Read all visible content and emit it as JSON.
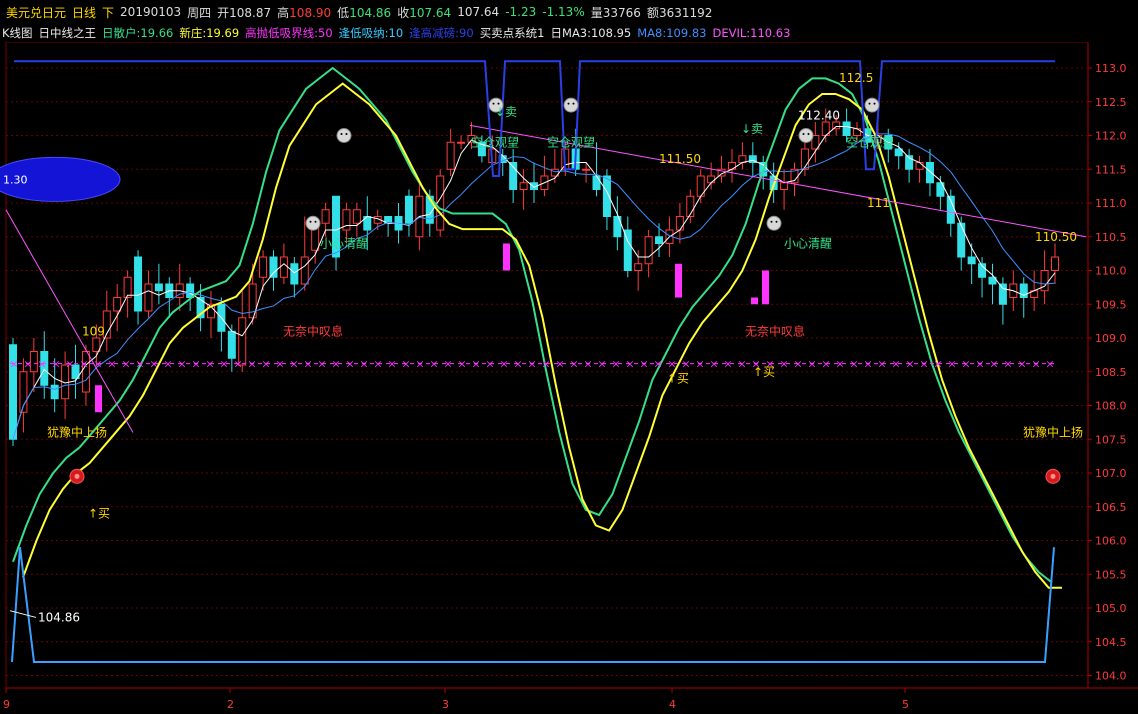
{
  "header": {
    "symbol": "美元兑日元",
    "period": "日线",
    "dir": "下",
    "date": "20190103",
    "weekday": "周四",
    "open_label": "开",
    "open": "108.87",
    "high_label": "高",
    "high": "108.90",
    "low_label": "低",
    "low": "104.86",
    "close_label": "收",
    "close": "107.64",
    "last": "107.64",
    "chg": "-1.23",
    "chg_pct": "-1.13%",
    "vol_label": "量",
    "vol": "33766",
    "amt_label": "额",
    "amt": "3631192"
  },
  "indicators": {
    "kline": "K线图",
    "study": "日中线之王",
    "sanhu": "日散户:19.66",
    "xinzhuang": "新庄:19.69",
    "gaopao": "高抛低吸界线:50",
    "fengdi": "逢低吸纳:10",
    "fenggao": "逢高减磅:90",
    "mmsys": "买卖点系统1",
    "ma3": "日MA3:108.95",
    "ma8": "MA8:109.83",
    "devil": "DEVIL:110.63"
  },
  "colors": {
    "up": "#ff3b3b",
    "down": "#33e0e8",
    "fast": "#35e08a",
    "slow": "#ffff33",
    "ma3": "#ffffff",
    "ma8": "#3f8fff",
    "trend": "#ff55ff",
    "blue": "#2b3fe6",
    "bottom": "#3aa0ff",
    "grid": "#6a0000",
    "magenta": "#ff33ff"
  },
  "chart_data": {
    "type": "candlestick",
    "ylim": [
      103.9,
      113.6
    ],
    "y_ticks": [
      "113.5",
      "113.0",
      "112.5",
      "112.0",
      "111.5",
      "111.0",
      "110.5",
      "110.0",
      "109.5",
      "109.0",
      "108.5",
      "108.0",
      "107.5",
      "107.0",
      "106.5",
      "106.0",
      "105.5",
      "105.0",
      "104.5",
      "104.0"
    ],
    "x_ticks": [
      "9",
      "2",
      "3",
      "4",
      "5"
    ],
    "candles": [
      [
        108.9,
        107.5,
        109.0,
        107.4
      ],
      [
        107.9,
        108.5,
        108.7,
        107.6
      ],
      [
        108.5,
        108.8,
        109.0,
        108.2
      ],
      [
        108.8,
        108.3,
        109.1,
        108.1
      ],
      [
        108.3,
        108.1,
        108.7,
        107.9
      ],
      [
        108.1,
        108.6,
        108.8,
        107.8
      ],
      [
        108.6,
        108.4,
        108.9,
        108.1
      ],
      [
        108.2,
        108.8,
        108.9,
        108.0
      ],
      [
        108.8,
        109.0,
        109.2,
        108.6
      ],
      [
        109.0,
        109.4,
        109.7,
        108.8
      ],
      [
        109.4,
        109.6,
        109.8,
        109.1
      ],
      [
        109.6,
        109.9,
        110.0,
        109.3
      ],
      [
        110.2,
        109.4,
        110.3,
        109.2
      ],
      [
        109.4,
        109.8,
        110.0,
        109.3
      ],
      [
        109.8,
        109.7,
        110.1,
        109.5
      ],
      [
        109.8,
        109.6,
        109.9,
        109.3
      ],
      [
        109.6,
        109.8,
        110.1,
        109.4
      ],
      [
        109.8,
        109.6,
        109.9,
        109.4
      ],
      [
        109.6,
        109.3,
        109.8,
        109.1
      ],
      [
        109.3,
        109.5,
        109.7,
        109.0
      ],
      [
        109.5,
        109.1,
        109.6,
        108.8
      ],
      [
        109.1,
        108.7,
        109.2,
        108.5
      ],
      [
        108.6,
        109.3,
        109.7,
        108.5
      ],
      [
        109.3,
        109.8,
        110.1,
        109.2
      ],
      [
        109.9,
        110.2,
        110.3,
        109.7
      ],
      [
        110.2,
        109.9,
        110.3,
        109.7
      ],
      [
        109.9,
        110.2,
        110.4,
        109.8
      ],
      [
        110.1,
        109.8,
        110.2,
        109.6
      ],
      [
        109.8,
        110.2,
        110.8,
        109.7
      ],
      [
        110.3,
        110.7,
        110.8,
        110.1
      ],
      [
        110.7,
        110.9,
        111.0,
        110.5
      ],
      [
        111.1,
        110.2,
        111.1,
        110.0
      ],
      [
        110.6,
        110.9,
        111.0,
        110.4
      ],
      [
        110.7,
        110.9,
        111.0,
        110.5
      ],
      [
        110.8,
        110.6,
        111.1,
        110.3
      ],
      [
        110.7,
        110.8,
        110.9,
        110.6
      ],
      [
        110.8,
        110.7,
        110.8,
        110.5
      ],
      [
        110.8,
        110.6,
        111.0,
        110.4
      ],
      [
        111.1,
        110.7,
        111.2,
        110.5
      ],
      [
        110.5,
        111.1,
        111.3,
        110.3
      ],
      [
        111.1,
        110.7,
        111.2,
        110.5
      ],
      [
        110.6,
        111.4,
        111.5,
        110.5
      ],
      [
        111.5,
        111.9,
        112.1,
        111.4
      ],
      [
        111.9,
        111.9,
        112.0,
        111.8
      ],
      [
        111.9,
        112.0,
        112.2,
        111.8
      ],
      [
        111.9,
        111.7,
        112.0,
        111.6
      ],
      [
        111.6,
        111.8,
        112.0,
        111.5
      ],
      [
        111.7,
        111.6,
        111.8,
        111.4
      ],
      [
        111.6,
        111.2,
        111.8,
        111.0
      ],
      [
        111.2,
        111.3,
        111.5,
        110.9
      ],
      [
        111.3,
        111.2,
        111.6,
        111.0
      ],
      [
        111.2,
        111.4,
        111.7,
        111.1
      ],
      [
        111.4,
        111.5,
        111.8,
        111.3
      ],
      [
        111.5,
        111.8,
        111.9,
        111.4
      ],
      [
        111.8,
        111.5,
        112.1,
        111.4
      ],
      [
        111.5,
        111.5,
        111.6,
        111.3
      ],
      [
        111.4,
        111.2,
        111.9,
        111.1
      ],
      [
        111.4,
        110.8,
        111.5,
        110.6
      ],
      [
        110.8,
        110.5,
        111.1,
        110.3
      ],
      [
        110.6,
        110.0,
        110.8,
        109.9
      ],
      [
        110.0,
        110.1,
        110.3,
        109.7
      ],
      [
        110.1,
        110.5,
        110.6,
        109.9
      ],
      [
        110.5,
        110.4,
        110.7,
        110.2
      ],
      [
        110.4,
        110.6,
        110.8,
        110.2
      ],
      [
        110.6,
        110.8,
        111.0,
        110.4
      ],
      [
        110.8,
        111.1,
        111.2,
        110.7
      ],
      [
        111.1,
        111.4,
        111.5,
        111.0
      ],
      [
        111.3,
        111.4,
        111.6,
        111.2
      ],
      [
        111.4,
        111.5,
        111.7,
        111.3
      ],
      [
        111.5,
        111.6,
        111.8,
        111.3
      ],
      [
        111.6,
        111.7,
        111.9,
        111.5
      ],
      [
        111.7,
        111.6,
        111.9,
        111.4
      ],
      [
        111.6,
        111.4,
        111.7,
        111.2
      ],
      [
        111.4,
        111.2,
        111.6,
        111.0
      ],
      [
        111.2,
        111.3,
        111.5,
        110.9
      ],
      [
        111.3,
        111.5,
        111.6,
        111.1
      ],
      [
        111.5,
        111.8,
        112.1,
        111.4
      ],
      [
        111.8,
        112.0,
        112.2,
        111.6
      ],
      [
        112.0,
        112.2,
        112.4,
        111.9
      ],
      [
        112.1,
        112.2,
        112.3,
        112.0
      ],
      [
        112.2,
        112.0,
        112.4,
        111.9
      ],
      [
        112.0,
        112.1,
        112.2,
        111.9
      ],
      [
        112.1,
        111.9,
        112.3,
        111.8
      ],
      [
        111.9,
        112.0,
        112.2,
        111.8
      ],
      [
        112.0,
        111.8,
        112.1,
        111.6
      ],
      [
        111.8,
        111.7,
        111.9,
        111.5
      ],
      [
        111.7,
        111.5,
        111.8,
        111.3
      ],
      [
        111.5,
        111.6,
        111.7,
        111.3
      ],
      [
        111.6,
        111.3,
        111.8,
        111.1
      ],
      [
        111.3,
        111.1,
        111.4,
        110.9
      ],
      [
        111.1,
        110.7,
        111.2,
        110.5
      ],
      [
        110.7,
        110.2,
        110.8,
        110.0
      ],
      [
        110.2,
        110.1,
        110.4,
        109.8
      ],
      [
        110.1,
        109.9,
        110.2,
        109.6
      ],
      [
        109.9,
        109.8,
        110.1,
        109.5
      ],
      [
        109.8,
        109.5,
        109.9,
        109.2
      ],
      [
        109.6,
        109.8,
        110.0,
        109.4
      ],
      [
        109.8,
        109.6,
        109.9,
        109.3
      ],
      [
        109.6,
        109.7,
        110.0,
        109.4
      ],
      [
        109.7,
        110.0,
        110.3,
        109.5
      ],
      [
        110.0,
        110.2,
        110.4,
        109.8
      ]
    ],
    "price_labels": [
      {
        "text": "109",
        "price": 109.1
      },
      {
        "text": "104.86",
        "price": 104.86
      },
      {
        "text": "111.50",
        "price": 111.65
      },
      {
        "text": "112.40",
        "price": 112.3
      },
      {
        "text": "112.5",
        "price": 112.85
      },
      {
        "text": "111",
        "price": 111.0
      },
      {
        "text": "110.50",
        "price": 110.5
      }
    ],
    "annotations": [
      "犹豫中上扬",
      "犹豫中上扬",
      "小心清醒",
      "小心清醒",
      "无奈中叹息",
      "无奈中叹息",
      "↑买",
      "↑买",
      "↑买",
      "↓卖",
      "↓卖",
      "空仓观望",
      "空仓观望",
      "空仓观望"
    ]
  }
}
